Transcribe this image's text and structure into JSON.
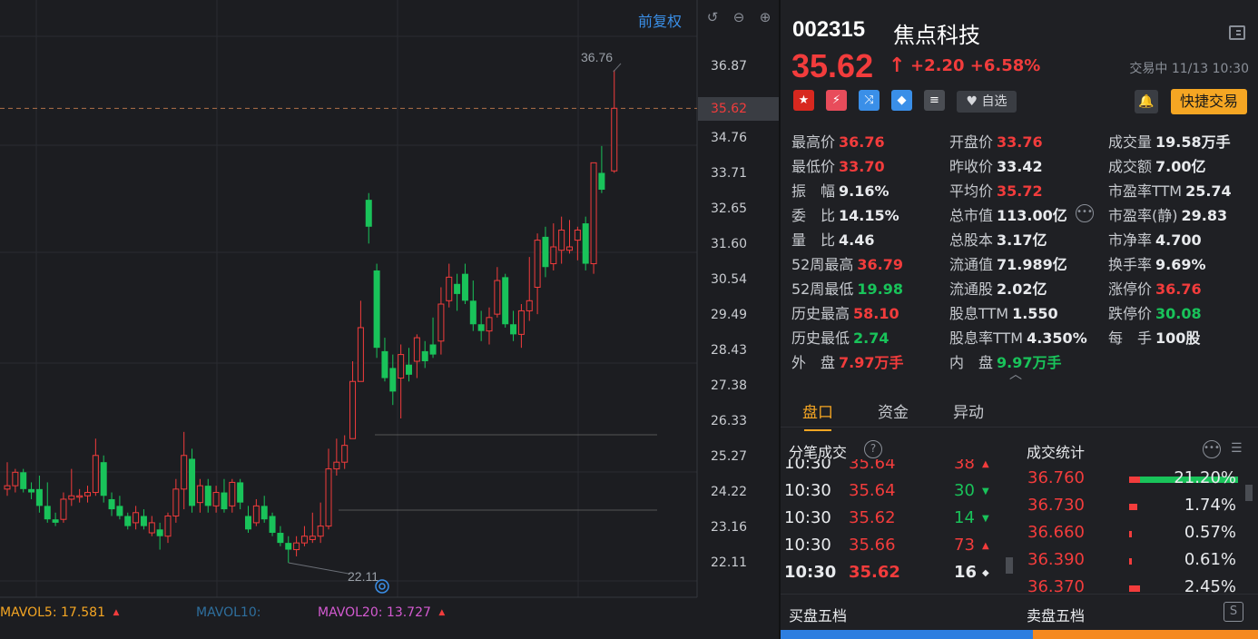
{
  "chart": {
    "fq_label": "前复权",
    "price_axis": [
      "36.87",
      "35.62",
      "34.76",
      "33.71",
      "32.65",
      "31.60",
      "30.54",
      "29.49",
      "28.43",
      "27.38",
      "26.33",
      "25.27",
      "24.22",
      "23.16",
      "22.11"
    ],
    "high_marker": "36.76",
    "low_marker": "22.11",
    "current_price_tag": "35.62",
    "mavol5_label": "MAVOL5:",
    "mavol5_value": "17.581",
    "mavol10_label": "MAVOL10:",
    "mavol20_label": "MAVOL20:",
    "mavol20_value": "13.727",
    "colors": {
      "up": "#f23c3c",
      "down": "#19c35a",
      "mavol5": "#f5a623",
      "mavol10": "#2e6f9e",
      "mavol20": "#d45ad1"
    }
  },
  "chart_data": {
    "type": "candlestick",
    "ylim": [
      21.6,
      37.4
    ],
    "candles": [
      {
        "o": 24.3,
        "h": 25.1,
        "l": 24.1,
        "c": 24.4
      },
      {
        "o": 24.4,
        "h": 24.9,
        "l": 24.2,
        "c": 24.8
      },
      {
        "o": 24.8,
        "h": 24.9,
        "l": 24.2,
        "c": 24.3
      },
      {
        "o": 24.3,
        "h": 24.5,
        "l": 24.0,
        "c": 24.2
      },
      {
        "o": 24.3,
        "h": 24.7,
        "l": 23.6,
        "c": 23.8
      },
      {
        "o": 23.8,
        "h": 24.5,
        "l": 23.3,
        "c": 23.4
      },
      {
        "o": 23.4,
        "h": 23.6,
        "l": 23.2,
        "c": 23.3
      },
      {
        "o": 23.4,
        "h": 24.2,
        "l": 23.3,
        "c": 24.0
      },
      {
        "o": 24.0,
        "h": 24.9,
        "l": 23.8,
        "c": 24.1
      },
      {
        "o": 24.1,
        "h": 24.3,
        "l": 23.9,
        "c": 24.1
      },
      {
        "o": 24.1,
        "h": 24.4,
        "l": 23.9,
        "c": 24.2
      },
      {
        "o": 24.2,
        "h": 25.8,
        "l": 24.1,
        "c": 25.3
      },
      {
        "o": 25.1,
        "h": 25.3,
        "l": 23.9,
        "c": 24.1
      },
      {
        "o": 24.0,
        "h": 24.2,
        "l": 23.5,
        "c": 23.7
      },
      {
        "o": 23.8,
        "h": 24.1,
        "l": 23.4,
        "c": 23.5
      },
      {
        "o": 23.5,
        "h": 23.6,
        "l": 23.1,
        "c": 23.2
      },
      {
        "o": 23.3,
        "h": 23.8,
        "l": 23.1,
        "c": 23.6
      },
      {
        "o": 23.5,
        "h": 23.7,
        "l": 23.1,
        "c": 23.2
      },
      {
        "o": 23.0,
        "h": 23.5,
        "l": 22.9,
        "c": 23.3
      },
      {
        "o": 23.1,
        "h": 23.3,
        "l": 22.5,
        "c": 22.9
      },
      {
        "o": 22.9,
        "h": 23.6,
        "l": 22.7,
        "c": 23.5
      },
      {
        "o": 23.5,
        "h": 24.6,
        "l": 23.3,
        "c": 24.3
      },
      {
        "o": 24.3,
        "h": 26.0,
        "l": 23.7,
        "c": 25.3
      },
      {
        "o": 25.2,
        "h": 25.5,
        "l": 23.6,
        "c": 23.8
      },
      {
        "o": 23.9,
        "h": 24.6,
        "l": 23.6,
        "c": 24.4
      },
      {
        "o": 24.4,
        "h": 24.6,
        "l": 23.6,
        "c": 23.8
      },
      {
        "o": 23.8,
        "h": 24.4,
        "l": 23.6,
        "c": 24.2
      },
      {
        "o": 24.2,
        "h": 24.6,
        "l": 23.6,
        "c": 23.7
      },
      {
        "o": 23.8,
        "h": 24.6,
        "l": 23.6,
        "c": 24.5
      },
      {
        "o": 24.5,
        "h": 24.6,
        "l": 23.7,
        "c": 23.9
      },
      {
        "o": 23.5,
        "h": 23.8,
        "l": 23.0,
        "c": 23.1
      },
      {
        "o": 23.3,
        "h": 24.0,
        "l": 23.2,
        "c": 23.8
      },
      {
        "o": 23.8,
        "h": 24.1,
        "l": 23.3,
        "c": 23.4
      },
      {
        "o": 23.5,
        "h": 23.6,
        "l": 22.9,
        "c": 23.0
      },
      {
        "o": 23.0,
        "h": 23.2,
        "l": 22.6,
        "c": 22.7
      },
      {
        "o": 22.7,
        "h": 22.9,
        "l": 22.11,
        "c": 22.5
      },
      {
        "o": 22.5,
        "h": 22.9,
        "l": 22.3,
        "c": 22.7
      },
      {
        "o": 22.7,
        "h": 23.2,
        "l": 22.6,
        "c": 22.9
      },
      {
        "o": 22.8,
        "h": 23.6,
        "l": 22.7,
        "c": 22.9
      },
      {
        "o": 22.9,
        "h": 23.9,
        "l": 22.7,
        "c": 23.2
      },
      {
        "o": 23.2,
        "h": 25.5,
        "l": 23.1,
        "c": 24.9
      },
      {
        "o": 24.9,
        "h": 25.8,
        "l": 24.7,
        "c": 25.1
      },
      {
        "o": 25.1,
        "h": 25.9,
        "l": 24.9,
        "c": 25.6
      },
      {
        "o": 25.8,
        "h": 28.1,
        "l": 25.8,
        "c": 27.5
      },
      {
        "o": 27.5,
        "h": 29.9,
        "l": 27.5,
        "c": 29.1
      },
      {
        "o": 32.9,
        "h": 33.1,
        "l": 31.6,
        "c": 32.1
      },
      {
        "o": 30.8,
        "h": 31.0,
        "l": 28.2,
        "c": 28.5
      },
      {
        "o": 28.4,
        "h": 28.8,
        "l": 27.5,
        "c": 27.6
      },
      {
        "o": 27.9,
        "h": 28.3,
        "l": 26.8,
        "c": 27.2
      },
      {
        "o": 27.6,
        "h": 28.6,
        "l": 26.4,
        "c": 28.3
      },
      {
        "o": 28.0,
        "h": 28.5,
        "l": 27.5,
        "c": 27.7
      },
      {
        "o": 28.1,
        "h": 28.9,
        "l": 27.6,
        "c": 28.8
      },
      {
        "o": 28.4,
        "h": 28.7,
        "l": 27.9,
        "c": 28.1
      },
      {
        "o": 28.6,
        "h": 29.4,
        "l": 28.2,
        "c": 28.3
      },
      {
        "o": 28.7,
        "h": 30.3,
        "l": 28.3,
        "c": 29.8
      },
      {
        "o": 29.9,
        "h": 31.0,
        "l": 29.7,
        "c": 30.6
      },
      {
        "o": 30.4,
        "h": 30.7,
        "l": 29.6,
        "c": 30.1
      },
      {
        "o": 30.7,
        "h": 31.0,
        "l": 29.8,
        "c": 29.9
      },
      {
        "o": 29.9,
        "h": 30.5,
        "l": 29.0,
        "c": 29.2
      },
      {
        "o": 29.2,
        "h": 29.6,
        "l": 28.7,
        "c": 29.0
      },
      {
        "o": 29.0,
        "h": 29.7,
        "l": 28.6,
        "c": 29.4
      },
      {
        "o": 29.5,
        "h": 30.9,
        "l": 29.4,
        "c": 30.5
      },
      {
        "o": 30.6,
        "h": 30.7,
        "l": 29.1,
        "c": 29.2
      },
      {
        "o": 29.2,
        "h": 29.6,
        "l": 28.7,
        "c": 28.9
      },
      {
        "o": 28.9,
        "h": 29.8,
        "l": 28.5,
        "c": 29.6
      },
      {
        "o": 29.6,
        "h": 31.2,
        "l": 29.3,
        "c": 29.9
      },
      {
        "o": 30.3,
        "h": 31.9,
        "l": 29.5,
        "c": 31.7
      },
      {
        "o": 31.8,
        "h": 32.1,
        "l": 30.6,
        "c": 30.9
      },
      {
        "o": 31.0,
        "h": 32.2,
        "l": 30.8,
        "c": 31.5
      },
      {
        "o": 31.4,
        "h": 32.4,
        "l": 31.0,
        "c": 32.0
      },
      {
        "o": 31.4,
        "h": 32.3,
        "l": 31.3,
        "c": 31.5
      },
      {
        "o": 31.7,
        "h": 32.1,
        "l": 31.1,
        "c": 32.0
      },
      {
        "o": 32.2,
        "h": 32.4,
        "l": 30.8,
        "c": 31.0
      },
      {
        "o": 31.0,
        "h": 34.0,
        "l": 30.7,
        "c": 34.0
      },
      {
        "o": 33.7,
        "h": 34.5,
        "l": 33.1,
        "c": 33.2
      },
      {
        "o": 33.76,
        "h": 36.76,
        "l": 33.7,
        "c": 35.62
      }
    ]
  },
  "header": {
    "code": "002315",
    "name": "焦点科技",
    "price": "35.62",
    "change": "+2.20 +6.58%",
    "status": "交易中 11/13 10:30",
    "watch_label": "自选",
    "quick_trade_label": "快捷交易"
  },
  "stats": [
    {
      "label": "最高价",
      "value": "36.76",
      "color": "red"
    },
    {
      "label": "开盘价",
      "value": "33.76",
      "color": "red"
    },
    {
      "label": "成交量",
      "value": "19.58万手",
      "color": "white"
    },
    {
      "label": "最低价",
      "value": "33.70",
      "color": "red"
    },
    {
      "label": "昨收价",
      "value": "33.42",
      "color": "white"
    },
    {
      "label": "成交额",
      "value": "7.00亿",
      "color": "white"
    },
    {
      "label": "振　幅",
      "value": "9.16%",
      "color": "white"
    },
    {
      "label": "平均价",
      "value": "35.72",
      "color": "red"
    },
    {
      "label": "市盈率TTM",
      "value": "25.74",
      "color": "white"
    },
    {
      "label": "委　比",
      "value": "14.15%",
      "color": "white"
    },
    {
      "label": "总市值",
      "value": "113.00亿",
      "color": "white"
    },
    {
      "label": "市盈率(静)",
      "value": "29.83",
      "color": "white"
    },
    {
      "label": "量　比",
      "value": "4.46",
      "color": "white"
    },
    {
      "label": "总股本",
      "value": "3.17亿",
      "color": "white"
    },
    {
      "label": "市净率",
      "value": "4.700",
      "color": "white"
    },
    {
      "label": "52周最高",
      "value": "36.79",
      "color": "red"
    },
    {
      "label": "流通值",
      "value": "71.989亿",
      "color": "white"
    },
    {
      "label": "换手率",
      "value": "9.69%",
      "color": "white"
    },
    {
      "label": "52周最低",
      "value": "19.98",
      "color": "green"
    },
    {
      "label": "流通股",
      "value": "2.02亿",
      "color": "white"
    },
    {
      "label": "涨停价",
      "value": "36.76",
      "color": "red"
    },
    {
      "label": "历史最高",
      "value": "58.10",
      "color": "red"
    },
    {
      "label": "股息TTM",
      "value": "1.550",
      "color": "white"
    },
    {
      "label": "跌停价",
      "value": "30.08",
      "color": "green"
    },
    {
      "label": "历史最低",
      "value": "2.74",
      "color": "green"
    },
    {
      "label": "股息率TTM",
      "value": "4.350%",
      "color": "white"
    },
    {
      "label": "每　手",
      "value": "100股",
      "color": "white"
    },
    {
      "label": "外　盘",
      "value": "7.97万手",
      "color": "red"
    },
    {
      "label": "内　盘",
      "value": "9.97万手",
      "color": "green"
    }
  ],
  "tabs": [
    "盘口",
    "资金",
    "异动"
  ],
  "ticks_title": "分笔成交",
  "ticks": [
    {
      "time": "10:30",
      "price": "35.64",
      "vol": "38",
      "dir": "up"
    },
    {
      "time": "10:30",
      "price": "35.64",
      "vol": "30",
      "dir": "down"
    },
    {
      "time": "10:30",
      "price": "35.62",
      "vol": "14",
      "dir": "down"
    },
    {
      "time": "10:30",
      "price": "35.66",
      "vol": "73",
      "dir": "up"
    },
    {
      "time": "10:30",
      "price": "35.62",
      "vol": "16",
      "dir": "neutral"
    }
  ],
  "vol_stats_title": "成交统计",
  "vol_stats": [
    {
      "price": "36.760",
      "pct": "21.20%",
      "share": 0.212
    },
    {
      "price": "36.730",
      "pct": "1.74%",
      "share": 0.0174
    },
    {
      "price": "36.660",
      "pct": "0.57%",
      "share": 0.0057
    },
    {
      "price": "36.390",
      "pct": "0.61%",
      "share": 0.0061
    },
    {
      "price": "36.370",
      "pct": "2.45%",
      "share": 0.0245
    }
  ],
  "order_book": {
    "buy_title": "买盘五档",
    "sell_title": "卖盘五档"
  }
}
